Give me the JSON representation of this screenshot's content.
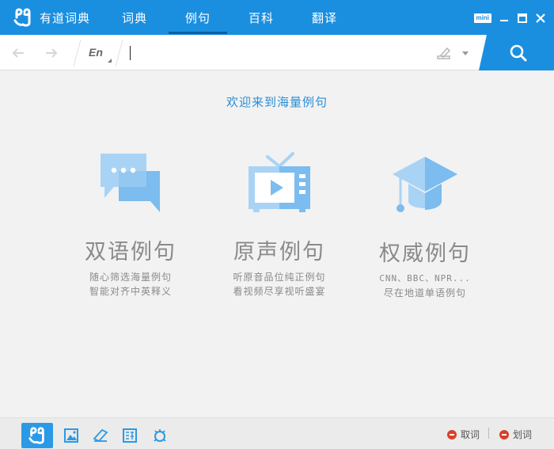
{
  "app": {
    "name": "有道词典"
  },
  "tabs": [
    {
      "label": "词典"
    },
    {
      "label": "例句"
    },
    {
      "label": "百科"
    },
    {
      "label": "翻译"
    }
  ],
  "active_tab": "例句",
  "window": {
    "mini_label": "mini"
  },
  "search": {
    "lang": "En",
    "value": ""
  },
  "main": {
    "welcome": "欢迎来到海量例句",
    "features": [
      {
        "title": "双语例句",
        "desc1": "随心筛选海量例句",
        "desc2": "智能对齐中英释义",
        "icon": "chat-bubbles-icon"
      },
      {
        "title": "原声例句",
        "desc1": "听原音品位纯正例句",
        "desc2": "看视频尽享视听盛宴",
        "icon": "tv-play-icon"
      },
      {
        "title": "权威例句",
        "desc1": "CNN、BBC、NPR...",
        "desc2": "尽在地道单语例句",
        "icon": "graduation-cap-icon"
      }
    ]
  },
  "bottom": {
    "qu_ci": "取词",
    "hua_ci": "划词"
  },
  "colors": {
    "brand": "#1a8fe0",
    "icon_light": "#a9d3f5",
    "icon_mid": "#7cbcee",
    "text_gray": "#8a8a8a",
    "red": "#d9402a"
  }
}
